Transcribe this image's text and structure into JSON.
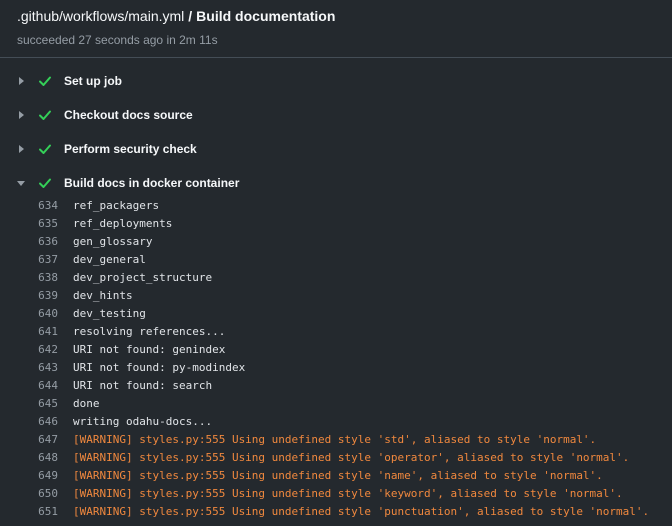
{
  "header": {
    "path": ".github/workflows/main.yml",
    "separator": "/",
    "job_name": "Build documentation",
    "status_text": "succeeded 27 seconds ago in 2m 11s"
  },
  "colors": {
    "success": "#34d058",
    "warning": "#f0883e",
    "background": "#24292e"
  },
  "steps": [
    {
      "label": "Set up job",
      "expanded": false,
      "icon": "check-icon"
    },
    {
      "label": "Checkout docs source",
      "expanded": false,
      "icon": "check-icon"
    },
    {
      "label": "Perform security check",
      "expanded": false,
      "icon": "check-icon"
    },
    {
      "label": "Build docs in docker container",
      "expanded": true,
      "icon": "check-icon"
    }
  ],
  "log_lines": [
    {
      "num": "634",
      "text": "ref_packagers",
      "warning": false
    },
    {
      "num": "635",
      "text": "ref_deployments",
      "warning": false
    },
    {
      "num": "636",
      "text": "gen_glossary",
      "warning": false
    },
    {
      "num": "637",
      "text": "dev_general",
      "warning": false
    },
    {
      "num": "638",
      "text": "dev_project_structure",
      "warning": false
    },
    {
      "num": "639",
      "text": "dev_hints",
      "warning": false
    },
    {
      "num": "640",
      "text": "dev_testing",
      "warning": false
    },
    {
      "num": "641",
      "text": "resolving references...",
      "warning": false
    },
    {
      "num": "642",
      "text": "URI not found: genindex",
      "warning": false
    },
    {
      "num": "643",
      "text": "URI not found: py-modindex",
      "warning": false
    },
    {
      "num": "644",
      "text": "URI not found: search",
      "warning": false
    },
    {
      "num": "645",
      "text": "done",
      "warning": false
    },
    {
      "num": "646",
      "text": "writing odahu-docs...",
      "warning": false
    },
    {
      "num": "647",
      "text": "[WARNING] styles.py:555 Using undefined style 'std', aliased to style 'normal'.",
      "warning": true
    },
    {
      "num": "648",
      "text": "[WARNING] styles.py:555 Using undefined style 'operator', aliased to style 'normal'.",
      "warning": true
    },
    {
      "num": "649",
      "text": "[WARNING] styles.py:555 Using undefined style 'name', aliased to style 'normal'.",
      "warning": true
    },
    {
      "num": "650",
      "text": "[WARNING] styles.py:555 Using undefined style 'keyword', aliased to style 'normal'.",
      "warning": true
    },
    {
      "num": "651",
      "text": "[WARNING] styles.py:555 Using undefined style 'punctuation', aliased to style 'normal'.",
      "warning": true
    }
  ]
}
